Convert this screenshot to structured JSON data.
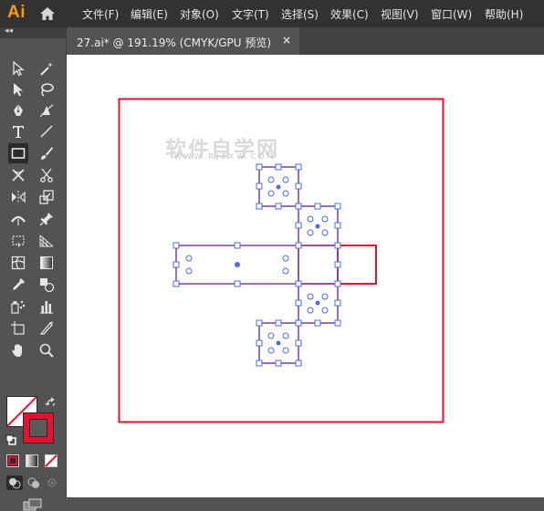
{
  "app": {
    "logo": "Ai"
  },
  "menu": {
    "items": [
      "文件(F)",
      "编辑(E)",
      "对象(O)",
      "文字(T)",
      "选择(S)",
      "效果(C)",
      "视图(V)",
      "窗口(W)",
      "帮助(H)"
    ]
  },
  "document": {
    "tab_title": "27.ai* @ 191.19% (CMYK/GPU 预览)",
    "close_glyph": "×"
  },
  "canvas": {
    "watermark_title": "软件自学网",
    "watermark_url": "WWW.RJZXW.COM"
  },
  "tools": [
    "selection-tool",
    "direct-selection-tool",
    "magic-wand-tool",
    "lasso-tool",
    "pen-tool",
    "curvature-tool",
    "type-tool",
    "line-segment-tool",
    "rectangle-tool",
    "paintbrush-tool",
    "shaper-tool",
    "scissors-tool",
    "reflect-tool",
    "scale-tool",
    "width-tool",
    "puppet-warp-tool",
    "free-transform-tool",
    "perspective-grid-tool",
    "mesh-tool",
    "gradient-tool",
    "eyedropper-tool",
    "blend-tool",
    "symbol-sprayer-tool",
    "column-graph-tool",
    "artboard-tool",
    "slice-tool",
    "hand-tool",
    "zoom-tool"
  ],
  "colors": {
    "accent_logo": "#ff9a00",
    "stroke": "#e8112d",
    "selection": "#4a6cf0"
  }
}
